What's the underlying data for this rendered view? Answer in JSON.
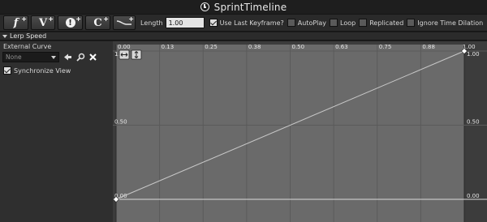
{
  "window": {
    "title": "SprintTimeline"
  },
  "toolbar": {
    "add_float_track": "f",
    "add_vector_track": "V",
    "add_event_track": "!",
    "add_color_track": "C",
    "length_label": "Length",
    "length_value": "1.00",
    "use_last_keyframe": {
      "label": "Use Last Keyframe?",
      "checked": true
    },
    "autoplay": {
      "label": "AutoPlay",
      "checked": false
    },
    "loop": {
      "label": "Loop",
      "checked": false
    },
    "replicated": {
      "label": "Replicated",
      "checked": false
    },
    "ignore_time_dilation": {
      "label": "Ignore Time Dilation",
      "checked": false
    }
  },
  "track": {
    "name": "Lerp Speed",
    "external_curve_label": "External Curve",
    "external_curve_value": "None",
    "synchronize_view": {
      "label": "Synchronize View",
      "checked": true
    }
  },
  "graph": {
    "x_ticks": [
      "0.00",
      "0.13",
      "0.25",
      "0.38",
      "0.50",
      "0.63",
      "0.75",
      "0.88",
      "1.00"
    ],
    "y_ticks": [
      "1.00",
      "0.50",
      "0.00"
    ],
    "keys": [
      {
        "time": 0.0,
        "value": 0.0
      },
      {
        "time": 1.0,
        "value": 1.0
      }
    ],
    "colors": {
      "active_bg": "#6a6a6a",
      "outer_bg": "#3c3c3c",
      "curve": "#c8c8c8",
      "grid": "#5a5a5a"
    }
  },
  "icons": {
    "toolbar": [
      "add-float-track-icon",
      "add-vector-track-icon",
      "add-event-track-icon",
      "add-color-track-icon",
      "add-external-curve-icon"
    ],
    "panel": [
      "use-selected-curve-icon",
      "browse-curve-icon",
      "clear-curve-icon"
    ],
    "graph": [
      "zoom-to-fit-horizontal-icon",
      "zoom-to-fit-vertical-icon"
    ]
  }
}
